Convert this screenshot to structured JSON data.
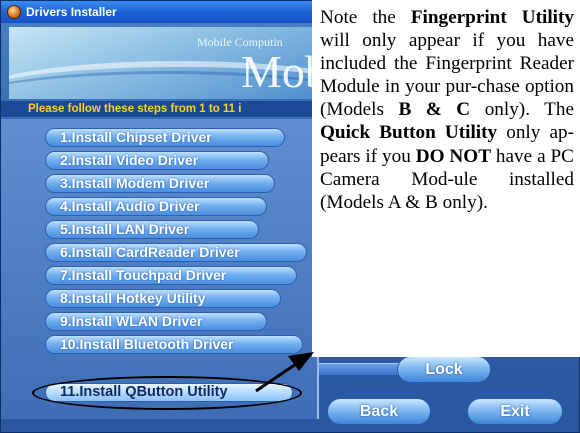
{
  "window": {
    "title": "Drivers Installer",
    "icon": "installer-disc-icon"
  },
  "banner": {
    "subtitle": "Mobile Computin",
    "big_text": "Mobi"
  },
  "instruction": "Please follow these steps from 1 to 11 i",
  "steps": [
    {
      "label": "1.Install Chipset Driver"
    },
    {
      "label": "2.Install Video Driver"
    },
    {
      "label": "3.Install Modem Driver"
    },
    {
      "label": "4.Install Audio Driver"
    },
    {
      "label": "5.Install LAN Driver"
    },
    {
      "label": "6.Install CardReader Driver"
    },
    {
      "label": "7.Install Touchpad Driver"
    },
    {
      "label": "8.Install Hotkey Utility"
    },
    {
      "label": "9.Install WLAN Driver"
    },
    {
      "label": "10.Install Bluetooth Driver"
    },
    {
      "label": "11.Install QButton Utility"
    }
  ],
  "buttons": {
    "lock": "Lock",
    "back": "Back",
    "exit": "Exit"
  },
  "note": {
    "t1": "Note the ",
    "b1": "Fingerprint Utility",
    "t2": " will only appear if you have included the Fingerprint Reader Module in your pur-chase option (Models ",
    "b2": "B & C",
    "t3": " only). The ",
    "b3": "Quick Button Utility",
    "t4": " only ap-pears if you ",
    "b4": "DO NOT",
    "t5": " have a PC Camera Mod-ule installed (Models A & B only)."
  },
  "colors": {
    "title_bar": "#1d63d8",
    "instruction_text": "#ffd21a",
    "button_blue": "#4a8ee0"
  }
}
